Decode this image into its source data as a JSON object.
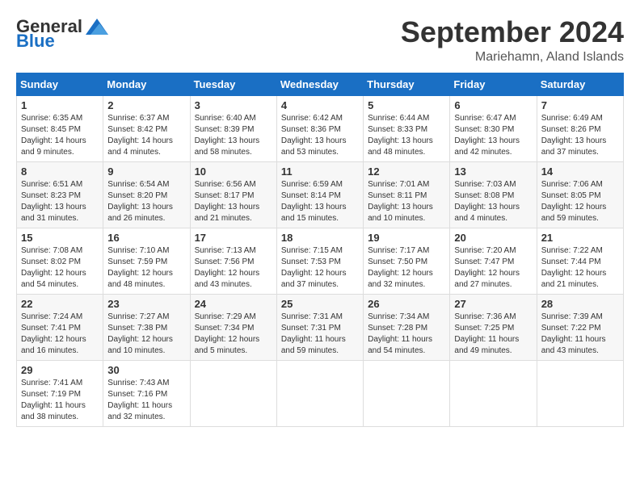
{
  "header": {
    "logo_general": "General",
    "logo_blue": "Blue",
    "month_title": "September 2024",
    "location": "Mariehamn, Aland Islands"
  },
  "days_of_week": [
    "Sunday",
    "Monday",
    "Tuesday",
    "Wednesday",
    "Thursday",
    "Friday",
    "Saturday"
  ],
  "weeks": [
    [
      {
        "day": "1",
        "sunrise": "6:35 AM",
        "sunset": "8:45 PM",
        "daylight": "14 hours and 9 minutes."
      },
      {
        "day": "2",
        "sunrise": "6:37 AM",
        "sunset": "8:42 PM",
        "daylight": "14 hours and 4 minutes."
      },
      {
        "day": "3",
        "sunrise": "6:40 AM",
        "sunset": "8:39 PM",
        "daylight": "13 hours and 58 minutes."
      },
      {
        "day": "4",
        "sunrise": "6:42 AM",
        "sunset": "8:36 PM",
        "daylight": "13 hours and 53 minutes."
      },
      {
        "day": "5",
        "sunrise": "6:44 AM",
        "sunset": "8:33 PM",
        "daylight": "13 hours and 48 minutes."
      },
      {
        "day": "6",
        "sunrise": "6:47 AM",
        "sunset": "8:30 PM",
        "daylight": "13 hours and 42 minutes."
      },
      {
        "day": "7",
        "sunrise": "6:49 AM",
        "sunset": "8:26 PM",
        "daylight": "13 hours and 37 minutes."
      }
    ],
    [
      {
        "day": "8",
        "sunrise": "6:51 AM",
        "sunset": "8:23 PM",
        "daylight": "13 hours and 31 minutes."
      },
      {
        "day": "9",
        "sunrise": "6:54 AM",
        "sunset": "8:20 PM",
        "daylight": "13 hours and 26 minutes."
      },
      {
        "day": "10",
        "sunrise": "6:56 AM",
        "sunset": "8:17 PM",
        "daylight": "13 hours and 21 minutes."
      },
      {
        "day": "11",
        "sunrise": "6:59 AM",
        "sunset": "8:14 PM",
        "daylight": "13 hours and 15 minutes."
      },
      {
        "day": "12",
        "sunrise": "7:01 AM",
        "sunset": "8:11 PM",
        "daylight": "13 hours and 10 minutes."
      },
      {
        "day": "13",
        "sunrise": "7:03 AM",
        "sunset": "8:08 PM",
        "daylight": "13 hours and 4 minutes."
      },
      {
        "day": "14",
        "sunrise": "7:06 AM",
        "sunset": "8:05 PM",
        "daylight": "12 hours and 59 minutes."
      }
    ],
    [
      {
        "day": "15",
        "sunrise": "7:08 AM",
        "sunset": "8:02 PM",
        "daylight": "12 hours and 54 minutes."
      },
      {
        "day": "16",
        "sunrise": "7:10 AM",
        "sunset": "7:59 PM",
        "daylight": "12 hours and 48 minutes."
      },
      {
        "day": "17",
        "sunrise": "7:13 AM",
        "sunset": "7:56 PM",
        "daylight": "12 hours and 43 minutes."
      },
      {
        "day": "18",
        "sunrise": "7:15 AM",
        "sunset": "7:53 PM",
        "daylight": "12 hours and 37 minutes."
      },
      {
        "day": "19",
        "sunrise": "7:17 AM",
        "sunset": "7:50 PM",
        "daylight": "12 hours and 32 minutes."
      },
      {
        "day": "20",
        "sunrise": "7:20 AM",
        "sunset": "7:47 PM",
        "daylight": "12 hours and 27 minutes."
      },
      {
        "day": "21",
        "sunrise": "7:22 AM",
        "sunset": "7:44 PM",
        "daylight": "12 hours and 21 minutes."
      }
    ],
    [
      {
        "day": "22",
        "sunrise": "7:24 AM",
        "sunset": "7:41 PM",
        "daylight": "12 hours and 16 minutes."
      },
      {
        "day": "23",
        "sunrise": "7:27 AM",
        "sunset": "7:38 PM",
        "daylight": "12 hours and 10 minutes."
      },
      {
        "day": "24",
        "sunrise": "7:29 AM",
        "sunset": "7:34 PM",
        "daylight": "12 hours and 5 minutes."
      },
      {
        "day": "25",
        "sunrise": "7:31 AM",
        "sunset": "7:31 PM",
        "daylight": "11 hours and 59 minutes."
      },
      {
        "day": "26",
        "sunrise": "7:34 AM",
        "sunset": "7:28 PM",
        "daylight": "11 hours and 54 minutes."
      },
      {
        "day": "27",
        "sunrise": "7:36 AM",
        "sunset": "7:25 PM",
        "daylight": "11 hours and 49 minutes."
      },
      {
        "day": "28",
        "sunrise": "7:39 AM",
        "sunset": "7:22 PM",
        "daylight": "11 hours and 43 minutes."
      }
    ],
    [
      {
        "day": "29",
        "sunrise": "7:41 AM",
        "sunset": "7:19 PM",
        "daylight": "11 hours and 38 minutes."
      },
      {
        "day": "30",
        "sunrise": "7:43 AM",
        "sunset": "7:16 PM",
        "daylight": "11 hours and 32 minutes."
      },
      null,
      null,
      null,
      null,
      null
    ]
  ]
}
